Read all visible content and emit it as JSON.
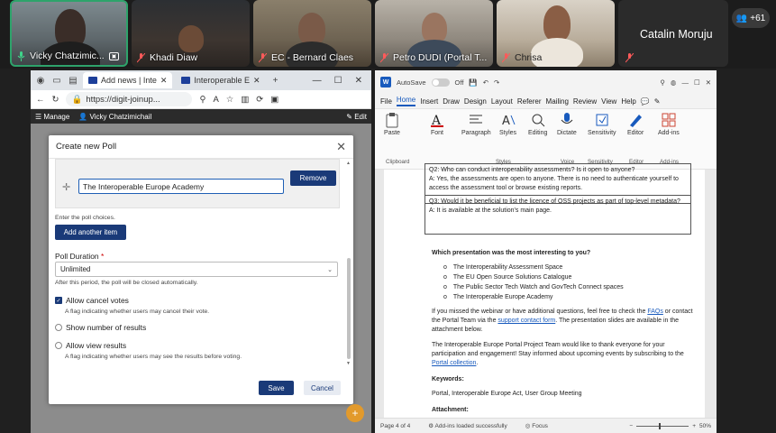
{
  "participants": [
    {
      "name": "Vicky Chatzimic...",
      "muted": false
    },
    {
      "name": "Khadi Diaw",
      "muted": true
    },
    {
      "name": "EC - Bernard Claes",
      "muted": true
    },
    {
      "name": "Petro DUDI (Portal T...",
      "muted": true
    },
    {
      "name": "Chrisa",
      "muted": true
    }
  ],
  "audio_only": {
    "name": "Catalin Moruju"
  },
  "more_count": "+61",
  "browser": {
    "tabs": [
      {
        "label": "Add news | Inte"
      },
      {
        "label": "Interoperable E"
      }
    ],
    "url": "https://digit-joinup...",
    "appbar": {
      "manage": "Manage",
      "user": "Vicky Chatzimichail",
      "edit": "Edit"
    }
  },
  "poll": {
    "title": "Create new Poll",
    "choice_value": "The Interoperable Europe Academy",
    "remove_label": "Remove",
    "choices_hint": "Enter the poll choices.",
    "add_label": "Add another item",
    "duration_label": "Poll Duration",
    "duration_required": "*",
    "duration_value": "Unlimited",
    "duration_hint": "After this period, the poll will be closed automatically.",
    "allow_cancel": "Allow cancel votes",
    "allow_cancel_hint": "A flag indicating whether users may cancel their vote.",
    "show_number": "Show number of results",
    "allow_view": "Allow view results",
    "allow_view_hint": "A flag indicating whether users may see the results before voting.",
    "save_label": "Save",
    "cancel_label": "Cancel"
  },
  "word": {
    "autosave": "AutoSave",
    "autosave_state": "Off",
    "menu": [
      "File",
      "Home",
      "Insert",
      "Draw",
      "Design",
      "Layout",
      "Referer",
      "Mailing",
      "Review",
      "View",
      "Help"
    ],
    "ribbon": {
      "paste": "Paste",
      "font": "Font",
      "paragraph": "Paragraph",
      "styles": "Styles",
      "editing": "Editing",
      "dictate": "Dictate",
      "sensitivity": "Sensitivity",
      "editor": "Editor",
      "addins": "Add-ins",
      "g_clipboard": "Clipboard",
      "g_styles": "Styles",
      "g_voice": "Voice",
      "g_sensitivity": "Sensitivity",
      "g_editor": "Editor",
      "g_addins": "Add-ins"
    },
    "doc": {
      "q2": "Q2: Who can conduct interoperability assessments? Is it open to anyone?",
      "a2": "A: Yes, the assessments are open to anyone. There is no need to authenticate yourself to access the assessment tool or browse existing reports.",
      "q3": "Q3: Would it be beneficial to list the licence of OSS projects as part of top-level metadata?",
      "a3": "A: It is available at the solution's main page.",
      "question": "Which presentation was the most interesting to you?",
      "options": [
        "The Interoperability Assessment Space",
        "The EU Open Source Solutions Catalogue",
        "The Public Sector Tech Watch and GovTech Connect spaces",
        "The Interoperable Europe Academy"
      ],
      "p1a": "If you missed the webinar or have additional questions, feel free to check the",
      "p1link1": "FAQs",
      "p1b": "or contact the Portal Team via the",
      "p1link2": "support contact form",
      "p1c": ". The presentation slides are available in the attachment below.",
      "p2a": "The Interoperable Europe Portal Project Team would like to thank everyone for your participation and engagement! Stay informed about upcoming events by subscribing to the",
      "p2link": "Portal collection",
      "p2b": ".",
      "keywords_label": "Keywords:",
      "keywords": "Portal, Interoperable Europe Act, User Group Meeting",
      "attachment": "Attachment:"
    },
    "status": {
      "page": "Page 4 of 4",
      "addins": "Add-ins loaded successfully",
      "focus": "Focus",
      "zoom": "50%"
    }
  }
}
